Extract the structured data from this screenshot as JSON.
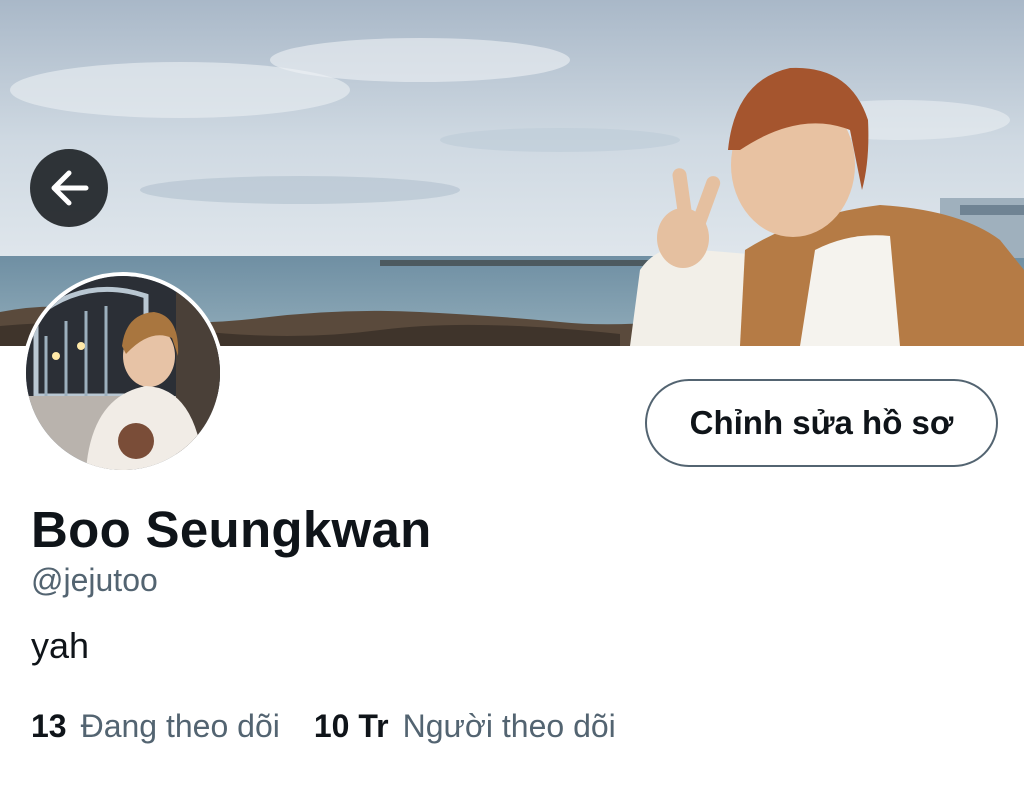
{
  "profile": {
    "display_name": "Boo Seungkwan",
    "handle": "@jejutoo",
    "bio": "yah",
    "edit_button_label": "Chỉnh sửa hồ sơ"
  },
  "stats": {
    "following": {
      "count": "13",
      "label": "Đang theo dõi"
    },
    "followers": {
      "count": "10 Tr",
      "label": "Người theo dõi"
    }
  },
  "icons": {
    "back": "arrow-left-icon"
  },
  "colors": {
    "primary_text": "#0f1419",
    "secondary_text": "#536471",
    "button_border": "#536471",
    "back_button_bg": "#1c2024"
  }
}
